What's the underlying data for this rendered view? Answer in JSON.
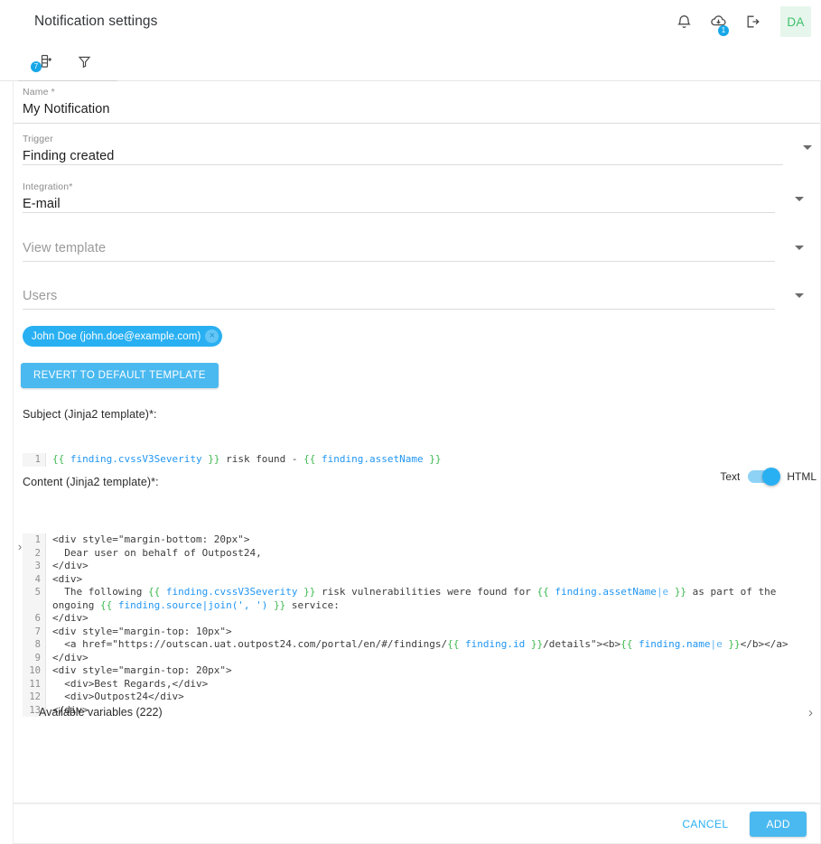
{
  "header": {
    "title": "Notification settings",
    "icons": [
      {
        "name": "notifications-bell-icon"
      },
      {
        "name": "cloud-download-icon",
        "badge": "1"
      },
      {
        "name": "logout-icon"
      }
    ],
    "avatar_initials": "DA"
  },
  "toolbar": {
    "add_notification_label": "",
    "add_badge": "7",
    "filter_label": ""
  },
  "form": {
    "name": {
      "label": "Name *",
      "value": "My Notification"
    },
    "trigger": {
      "label": "Trigger",
      "value": "Finding created"
    },
    "integration": {
      "label": "Integration*",
      "value": "E-mail"
    },
    "view_template": {
      "label": "View template",
      "placeholder": "View template",
      "value": ""
    },
    "users": {
      "label": "Users",
      "placeholder": "Users",
      "value": ""
    },
    "user_chips": [
      {
        "label": "John Doe (john.doe@example.com)",
        "remove": "×"
      }
    ],
    "revert_button": "REVERT TO DEFAULT TEMPLATE"
  },
  "subject": {
    "label": "Subject (Jinja2 template)*:",
    "lines": [
      {
        "n": "1",
        "tokens": [
          {
            "t": "{{",
            "c": "brace"
          },
          {
            "t": " ",
            "c": "plain"
          },
          {
            "t": "finding.cvssV3Severity",
            "c": "var"
          },
          {
            "t": " ",
            "c": "plain"
          },
          {
            "t": "}}",
            "c": "brace"
          },
          {
            "t": " risk found - ",
            "c": "plain"
          },
          {
            "t": "{{",
            "c": "brace"
          },
          {
            "t": " ",
            "c": "plain"
          },
          {
            "t": "finding.assetName",
            "c": "var"
          },
          {
            "t": " ",
            "c": "plain"
          },
          {
            "t": "}}",
            "c": "brace"
          }
        ]
      }
    ]
  },
  "content": {
    "label": "Content (Jinja2 template)*:",
    "toggle": {
      "left_label": "Text",
      "right_label": "HTML",
      "state": "HTML"
    },
    "lines": [
      {
        "n": "1",
        "tokens": [
          {
            "t": "<div style=\"margin-bottom: 20px\">",
            "c": "plain"
          }
        ]
      },
      {
        "n": "2",
        "tokens": [
          {
            "t": "  Dear user on behalf of Outpost24,",
            "c": "plain"
          }
        ]
      },
      {
        "n": "3",
        "tokens": [
          {
            "t": "</div>",
            "c": "plain"
          }
        ]
      },
      {
        "n": "4",
        "tokens": [
          {
            "t": "<div>",
            "c": "plain"
          }
        ]
      },
      {
        "n": "5",
        "tokens": [
          {
            "t": "  The following ",
            "c": "plain"
          },
          {
            "t": "{{",
            "c": "brace"
          },
          {
            "t": " ",
            "c": "plain"
          },
          {
            "t": "finding.cvssV3Severity",
            "c": "var"
          },
          {
            "t": " ",
            "c": "plain"
          },
          {
            "t": "}}",
            "c": "brace"
          },
          {
            "t": " risk vulnerabilities were found for ",
            "c": "plain"
          },
          {
            "t": "{{",
            "c": "brace"
          },
          {
            "t": " ",
            "c": "plain"
          },
          {
            "t": "finding.assetName",
            "c": "var"
          },
          {
            "t": "|e",
            "c": "filter"
          },
          {
            "t": " ",
            "c": "plain"
          },
          {
            "t": "}}",
            "c": "brace"
          },
          {
            "t": " as part of the ongoing ",
            "c": "plain"
          },
          {
            "t": "{{",
            "c": "brace"
          },
          {
            "t": " ",
            "c": "plain"
          },
          {
            "t": "finding.source|join(', ')",
            "c": "var"
          },
          {
            "t": " ",
            "c": "plain"
          },
          {
            "t": "}}",
            "c": "brace"
          },
          {
            "t": " service:",
            "c": "plain"
          }
        ]
      },
      {
        "n": "6",
        "tokens": [
          {
            "t": "</div>",
            "c": "plain"
          }
        ]
      },
      {
        "n": "7",
        "tokens": [
          {
            "t": "<div style=\"margin-top: 10px\">",
            "c": "plain"
          }
        ]
      },
      {
        "n": "8",
        "tokens": [
          {
            "t": "  <a href=\"https://outscan.uat.outpost24.com/portal/en/#/findings/",
            "c": "plain"
          },
          {
            "t": "{{",
            "c": "brace"
          },
          {
            "t": " ",
            "c": "plain"
          },
          {
            "t": "finding.id",
            "c": "var"
          },
          {
            "t": " ",
            "c": "plain"
          },
          {
            "t": "}}",
            "c": "brace"
          },
          {
            "t": "/details\"><b>",
            "c": "plain"
          },
          {
            "t": "{{",
            "c": "brace"
          },
          {
            "t": " ",
            "c": "plain"
          },
          {
            "t": "finding.name",
            "c": "var"
          },
          {
            "t": "|e",
            "c": "filter"
          },
          {
            "t": " ",
            "c": "plain"
          },
          {
            "t": "}}",
            "c": "brace"
          },
          {
            "t": "</b></a>",
            "c": "plain"
          }
        ]
      },
      {
        "n": "9",
        "tokens": [
          {
            "t": "</div>",
            "c": "plain"
          }
        ]
      },
      {
        "n": "10",
        "tokens": [
          {
            "t": "<div style=\"margin-top: 20px\">",
            "c": "plain"
          }
        ]
      },
      {
        "n": "11",
        "tokens": [
          {
            "t": "  <div>Best Regards,</div>",
            "c": "plain"
          }
        ]
      },
      {
        "n": "12",
        "tokens": [
          {
            "t": "  <div>Outpost24</div>",
            "c": "plain"
          }
        ]
      },
      {
        "n": "13",
        "tokens": [
          {
            "t": "</div>",
            "c": "plain"
          }
        ]
      }
    ]
  },
  "available_variables": {
    "label": "Available variables (222)",
    "chevron": "›"
  },
  "footer": {
    "cancel_label": "CANCEL",
    "add_label": "ADD"
  },
  "colors": {
    "accent": "#29b0f2",
    "button": "#4ab9f0",
    "avatar_bg": "#e6f6ec",
    "avatar_fg": "#3cc06a",
    "jinja_brace": "#3fb950",
    "jinja_var": "#2196f3"
  }
}
